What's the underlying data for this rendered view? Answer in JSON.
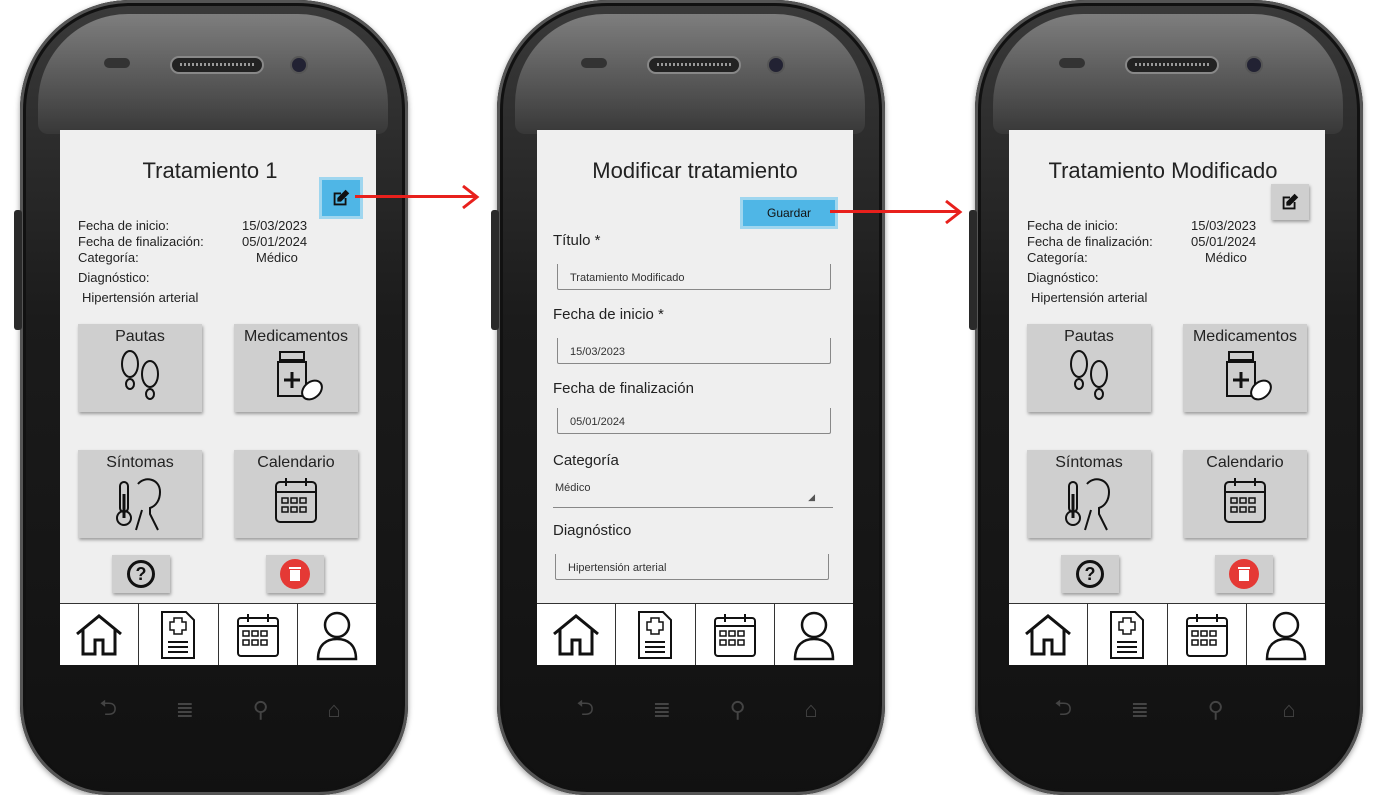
{
  "screen1": {
    "title": "Tratamiento 1",
    "start_label": "Fecha de inicio:",
    "start_value": "15/03/2023",
    "end_label": "Fecha de finalización:",
    "end_value": "05/01/2024",
    "category_label": "Categoría:",
    "category_value": "Médico",
    "diagnosis_label": "Diagnóstico:",
    "diagnosis_value": "Hipertensión arterial",
    "tiles": {
      "pautas": "Pautas",
      "medicamentos": "Medicamentos",
      "sintomas": "Síntomas",
      "calendario": "Calendario"
    }
  },
  "screen2": {
    "title": "Modificar tratamiento",
    "save_label": "Guardar",
    "title_label": "Título  *",
    "title_value": "Tratamiento Modificado",
    "start_label": "Fecha de inicio  *",
    "start_value": "15/03/2023",
    "end_label": "Fecha de finalización",
    "end_value": "05/01/2024",
    "category_label": "Categoría",
    "category_value": "Médico",
    "diagnosis_label": "Diagnóstico",
    "diagnosis_value": "Hipertensión arterial"
  },
  "screen3": {
    "title": "Tratamiento Modificado",
    "start_label": "Fecha de inicio:",
    "start_value": "15/03/2023",
    "end_label": "Fecha de finalización:",
    "end_value": "05/01/2024",
    "category_label": "Categoría:",
    "category_value": "Médico",
    "diagnosis_label": "Diagnóstico:",
    "diagnosis_value": "Hipertensión arterial",
    "tiles": {
      "pautas": "Pautas",
      "medicamentos": "Medicamentos",
      "sintomas": "Síntomas",
      "calendario": "Calendario"
    }
  },
  "icons": {
    "edit": "edit-pencil-icon",
    "help": "question-icon",
    "delete": "trash-icon",
    "nav": [
      "home-icon",
      "medical-record-icon",
      "calendar-icon",
      "profile-icon"
    ],
    "hardware": [
      "back-icon",
      "menu-icon",
      "search-icon",
      "home-outline-icon"
    ]
  },
  "colors": {
    "accent": "#4fb6e6",
    "arrow": "#e8201c",
    "delete": "#e53935",
    "tile": "#cfcfcf",
    "screen": "#efefef"
  }
}
